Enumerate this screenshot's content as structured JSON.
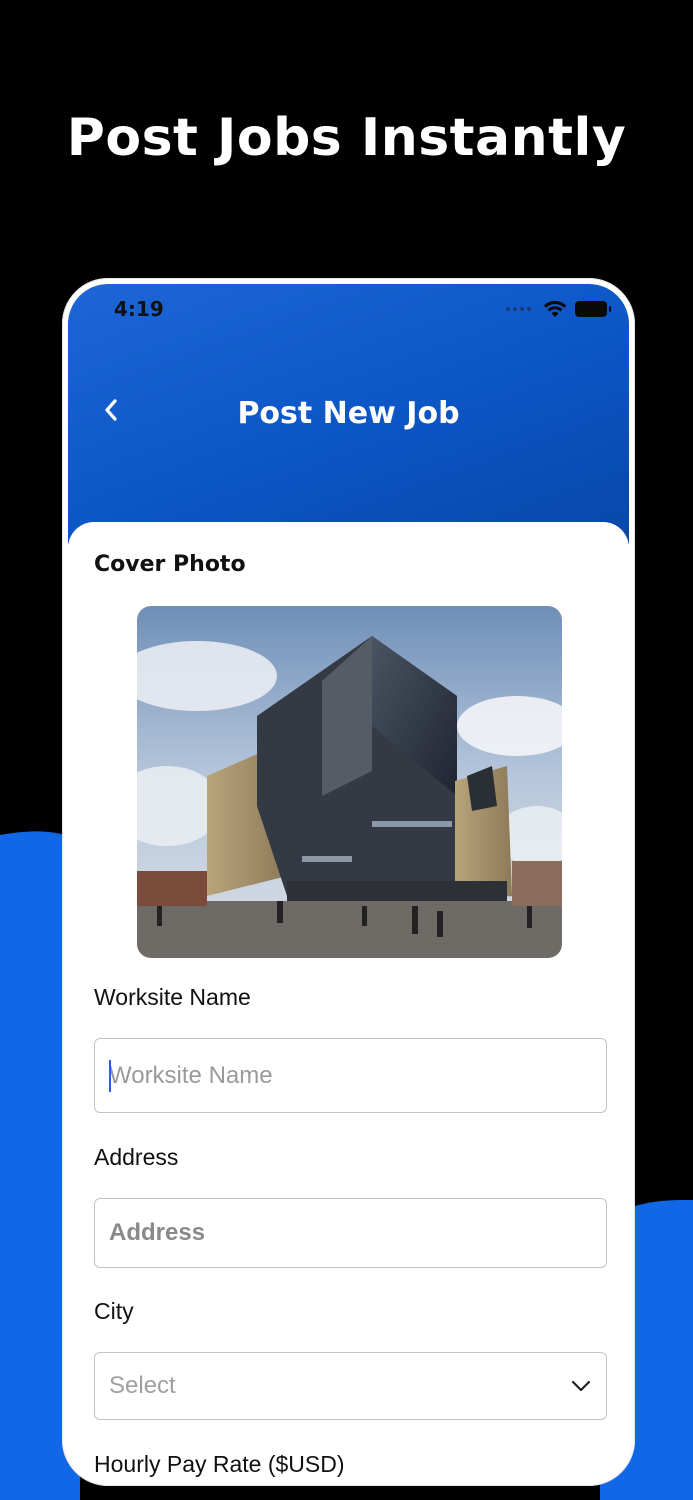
{
  "headline": "Post Jobs Instantly",
  "colors": {
    "accent": "#1068E6",
    "header": "#0B55C4"
  },
  "status_bar": {
    "time": "4:19",
    "icons": [
      "signal-dots-icon",
      "wifi-icon",
      "battery-icon"
    ]
  },
  "nav": {
    "title": "Post New Job",
    "back_icon": "chevron-left-icon"
  },
  "form": {
    "cover_photo_label": "Cover Photo",
    "worksite": {
      "label": "Worksite Name",
      "placeholder": "Worksite Name",
      "value": ""
    },
    "address": {
      "label": "Address",
      "placeholder": "Address",
      "value": ""
    },
    "city": {
      "label": "City",
      "selected": "Select",
      "icon": "chevron-down-icon"
    },
    "pay_rate": {
      "label": "Hourly Pay Rate ($USD)"
    }
  }
}
